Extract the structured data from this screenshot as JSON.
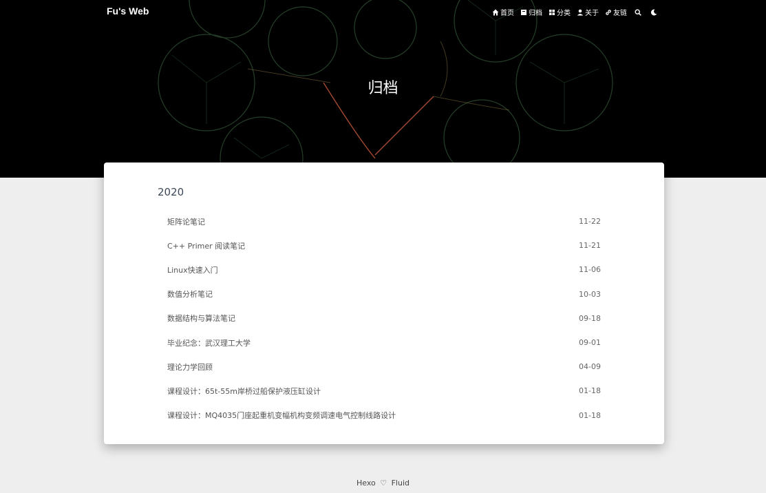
{
  "header": {
    "brand": "Fu's Web",
    "nav": [
      {
        "label": "首页",
        "icon": "home-icon"
      },
      {
        "label": "归档",
        "icon": "archive-icon"
      },
      {
        "label": "分类",
        "icon": "category-icon"
      },
      {
        "label": "关于",
        "icon": "user-icon"
      },
      {
        "label": "友链",
        "icon": "link-icon"
      }
    ],
    "search_icon": "search-icon",
    "theme_icon": "moon-icon"
  },
  "banner": {
    "title": "归档"
  },
  "archive": {
    "year": "2020",
    "posts": [
      {
        "title": "矩阵论笔记",
        "date": "11-22"
      },
      {
        "title": "C++ Primer 阅读笔记",
        "date": "11-21"
      },
      {
        "title": "Linux快速入门",
        "date": "11-06"
      },
      {
        "title": "数值分析笔记",
        "date": "10-03"
      },
      {
        "title": "数据结构与算法笔记",
        "date": "09-18"
      },
      {
        "title": "毕业纪念：武汉理工大学",
        "date": "09-01"
      },
      {
        "title": "理论力学回顾",
        "date": "04-09"
      },
      {
        "title": "课程设计：65t-55m岸桥过船保护液压缸设计",
        "date": "01-18"
      },
      {
        "title": "课程设计：MQ4035门座起重机变幅机构变频调速电气控制线路设计",
        "date": "01-18"
      }
    ]
  },
  "footer": {
    "left": "Hexo",
    "right": "Fluid",
    "heart_icon": "heart-icon"
  },
  "colors": {
    "banner_bg": "#000000",
    "page_bg": "#eeeeee",
    "card_bg": "#ffffff",
    "accent_orange": "#c4563a",
    "pattern_green": "#3f6b44"
  }
}
